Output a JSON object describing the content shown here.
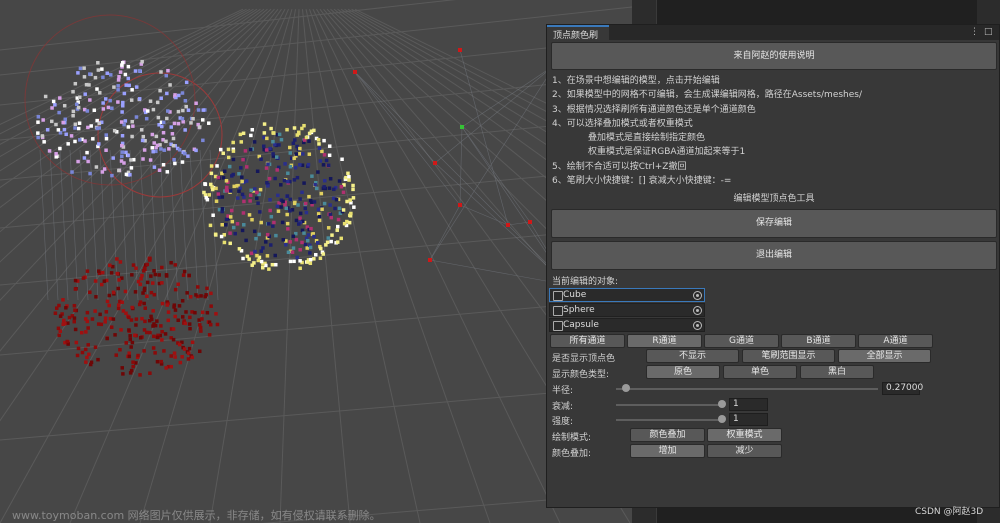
{
  "window": {
    "tab_title": "顶点颜色刷",
    "menu_icon": "⋮",
    "maximize_icon": "□"
  },
  "instructions": {
    "header_button": "来自阿赵的使用说明",
    "lines": [
      "1、在场景中想编辑的模型，点击开始编辑",
      "2、如果模型中的网格不可编辑，会生成课编辑网格，路径在Assets/meshes/",
      "3、根据情况选择刷所有通道颜色还是单个通道颜色",
      "4、可以选择叠加模式或者权重模式",
      "叠加模式是直接绘制指定颜色",
      "权重模式是保证RGBA通道加起来等于1",
      "5、绘制不合适可以按Ctrl+Z撤回",
      "6、笔刷大小快捷键：[]  衰减大小快捷键：-="
    ]
  },
  "tool": {
    "section_title": "编辑模型顶点色工具",
    "save_button": "保存编辑",
    "exit_button": "退出编辑"
  },
  "objects": {
    "label": "当前编辑的对象:",
    "items": [
      "Cube",
      "Sphere",
      "Capsule"
    ]
  },
  "channels": {
    "options": [
      "所有通道",
      "R通道",
      "G通道",
      "B通道",
      "A通道"
    ],
    "selected": 1
  },
  "show_vertex": {
    "label": "是否显示顶点色",
    "options": [
      "不显示",
      "笔刷范围显示",
      "全部显示"
    ],
    "selected": 2
  },
  "color_type": {
    "label": "显示颜色类型:",
    "options": [
      "原色",
      "单色",
      "黑白"
    ],
    "selected": 0
  },
  "radius": {
    "label": "半径:",
    "value": "0.27000",
    "slider": 0.04
  },
  "falloff": {
    "label": "衰减:",
    "value": "1",
    "slider": 1
  },
  "strength": {
    "label": "强度:",
    "value": "1",
    "slider": 1
  },
  "draw_mode": {
    "label": "绘制模式:",
    "options": [
      "颜色叠加",
      "权重模式"
    ],
    "selected": 1
  },
  "blend": {
    "label": "颜色叠加:",
    "options": [
      "增加",
      "减少"
    ],
    "selected": 0
  },
  "watermark": "www.toymoban.com 网络图片仅供展示，非存储，如有侵权请联系删除。",
  "credit": "CSDN @阿赵3D",
  "colors": {
    "accent": "#3a79bb",
    "panel_bg": "#383838",
    "button": "#585858",
    "button_selected": "#6a6a6a"
  }
}
